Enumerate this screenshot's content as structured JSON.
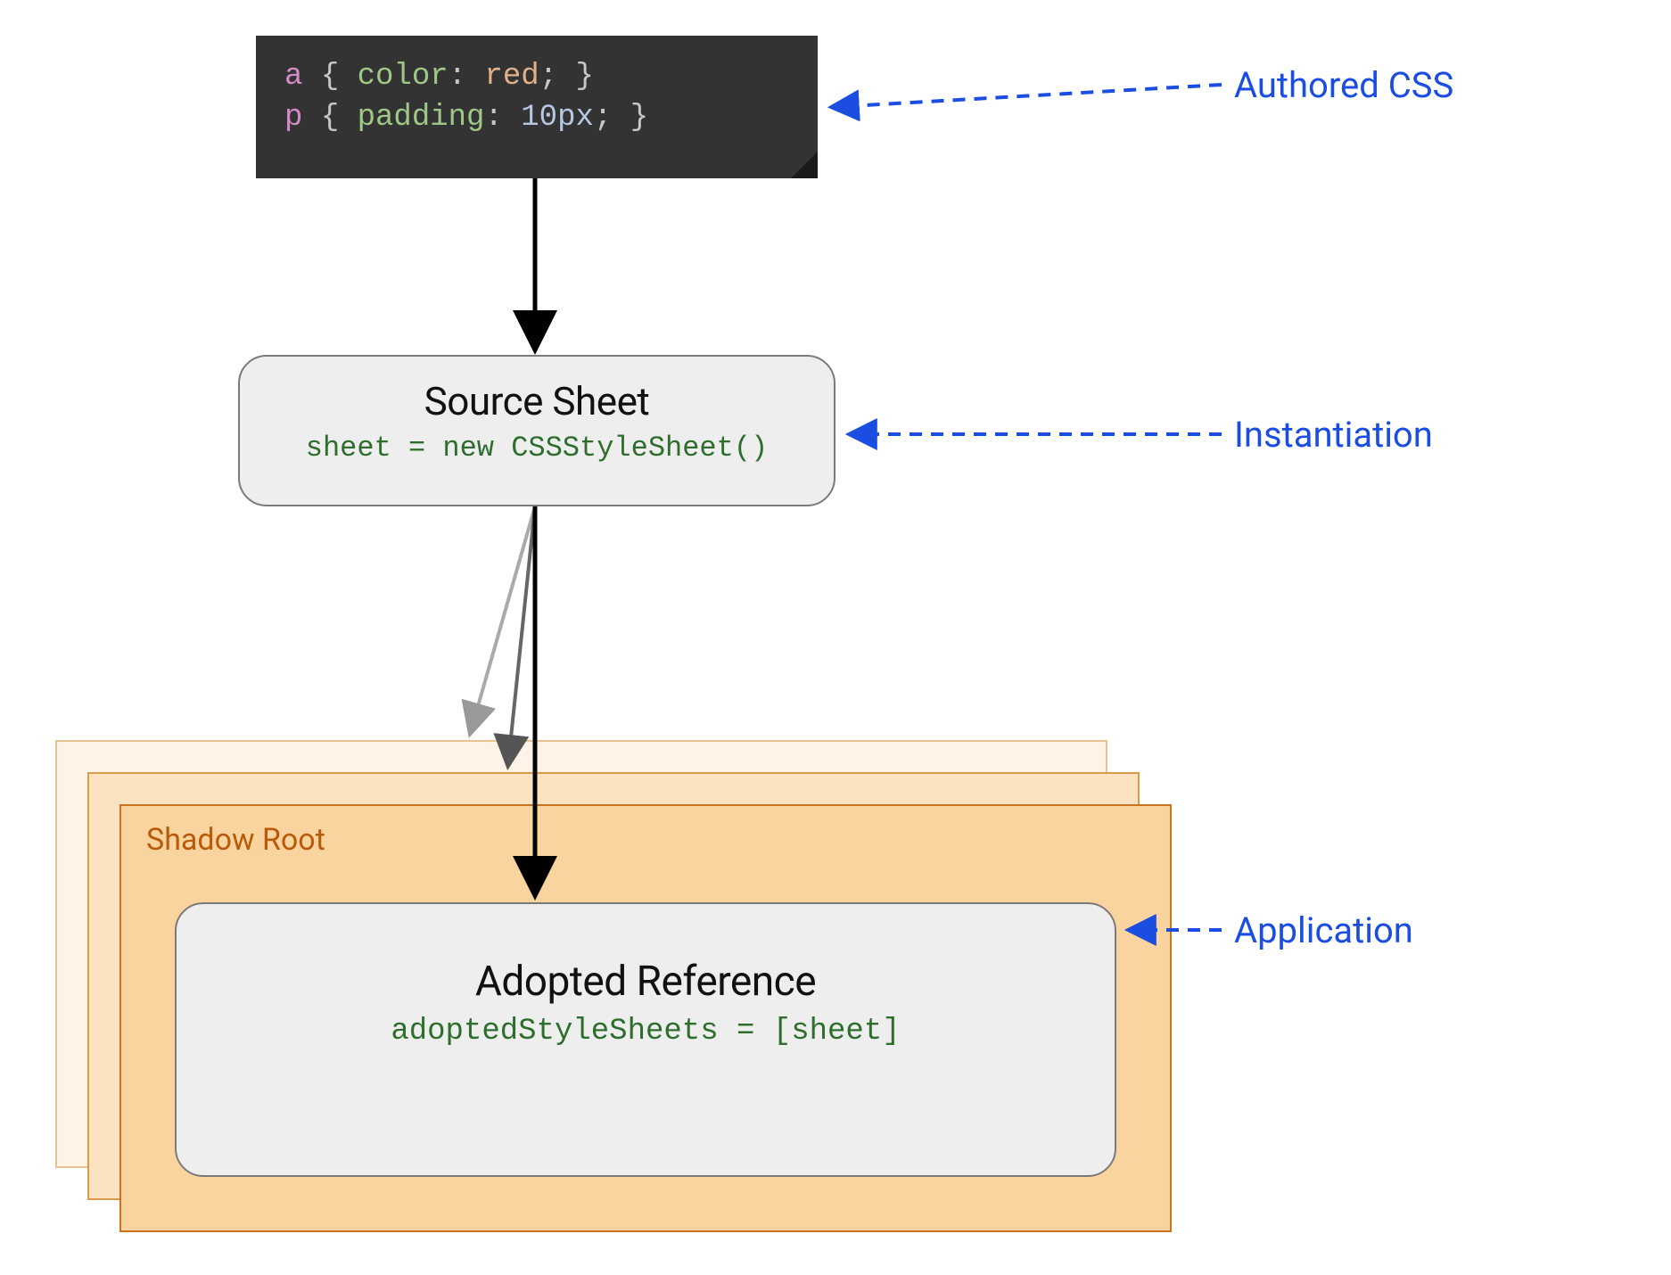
{
  "code": {
    "line1": {
      "selector": "a",
      "brace_open": "{",
      "prop": "color",
      "colon": ":",
      "value": "red",
      "semi": ";",
      "brace_close": "}"
    },
    "line2": {
      "selector": "p",
      "brace_open": "{",
      "prop": "padding",
      "colon": ":",
      "value": "10px",
      "semi": ";",
      "brace_close": "}"
    }
  },
  "source_sheet": {
    "title": "Source Sheet",
    "code": "sheet = new CSSStyleSheet()"
  },
  "shadow_root": {
    "label": "Shadow Root"
  },
  "adopted": {
    "title": "Adopted Reference",
    "code": "adoptedStyleSheets = [sheet]"
  },
  "annotations": {
    "authored": "Authored CSS",
    "instantiation": "Instantiation",
    "application": "Application"
  }
}
